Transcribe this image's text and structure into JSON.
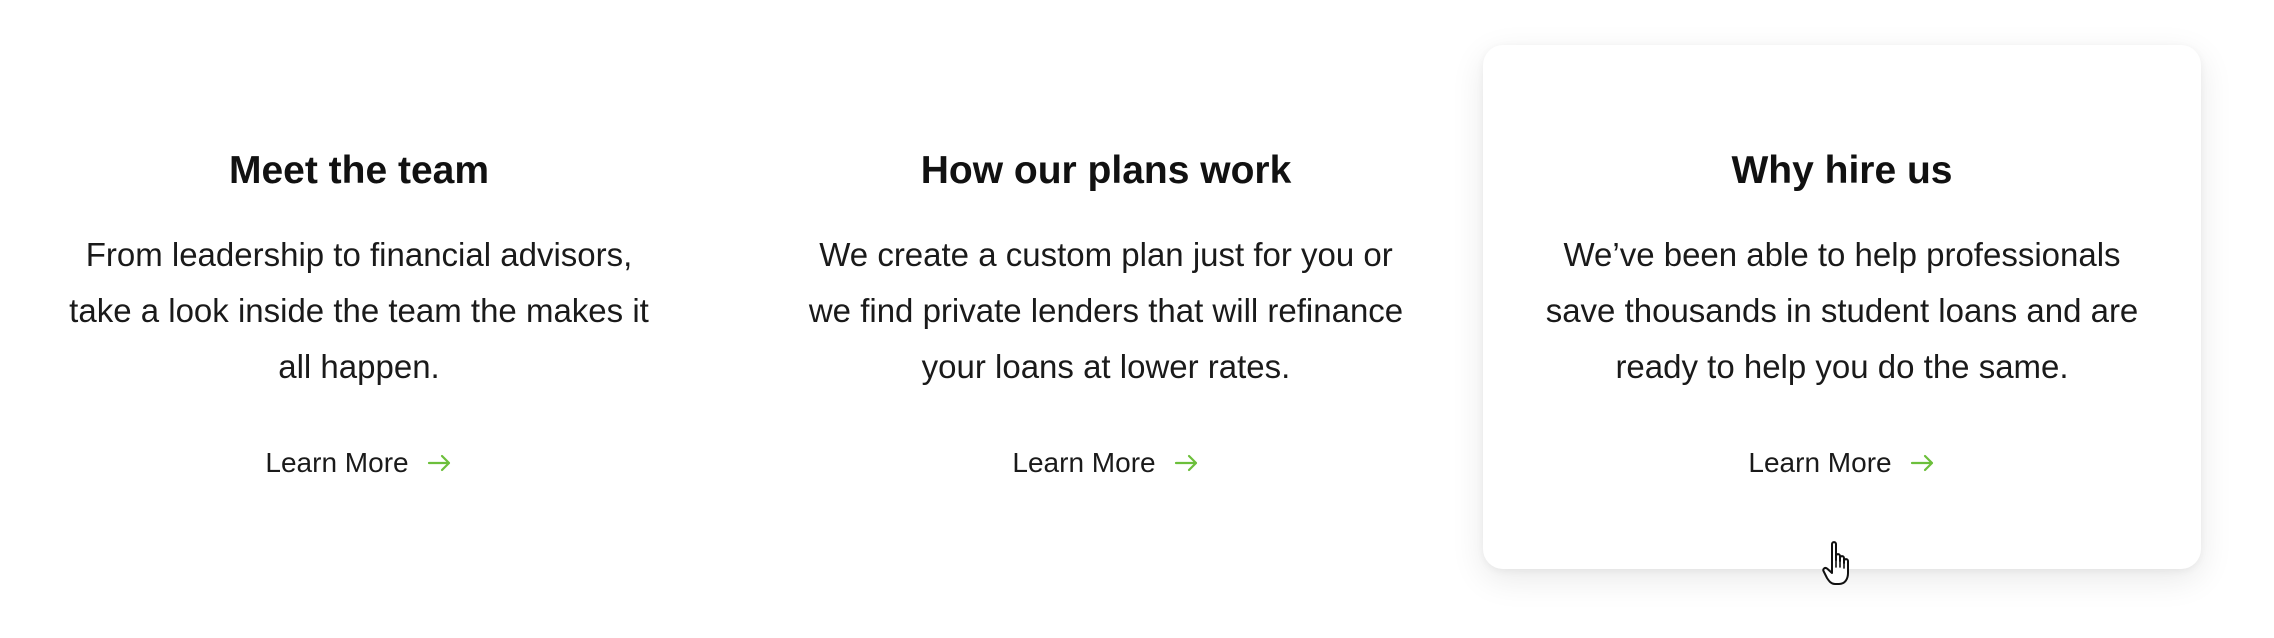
{
  "cards": [
    {
      "title": "Meet the team",
      "text": "From leadership to financial advisors, take a look inside the team the makes it all happen.",
      "link_label": "Learn More",
      "link_icon": "arrow-right-icon"
    },
    {
      "title": "How our plans work",
      "text": "We create a custom plan just for you or we find private lenders that will refinance your loans at lower rates.",
      "link_label": "Learn More",
      "link_icon": "arrow-right-icon"
    },
    {
      "title": "Why hire us",
      "text": "We’ve been able to help professionals save thousands in student loans and are ready to help you do the same.",
      "link_label": "Learn More",
      "link_icon": "arrow-right-icon"
    }
  ],
  "colors": {
    "accent": "#6cbf3b",
    "text": "#111111",
    "background": "#ffffff"
  },
  "cursor": "hand-pointer-icon"
}
